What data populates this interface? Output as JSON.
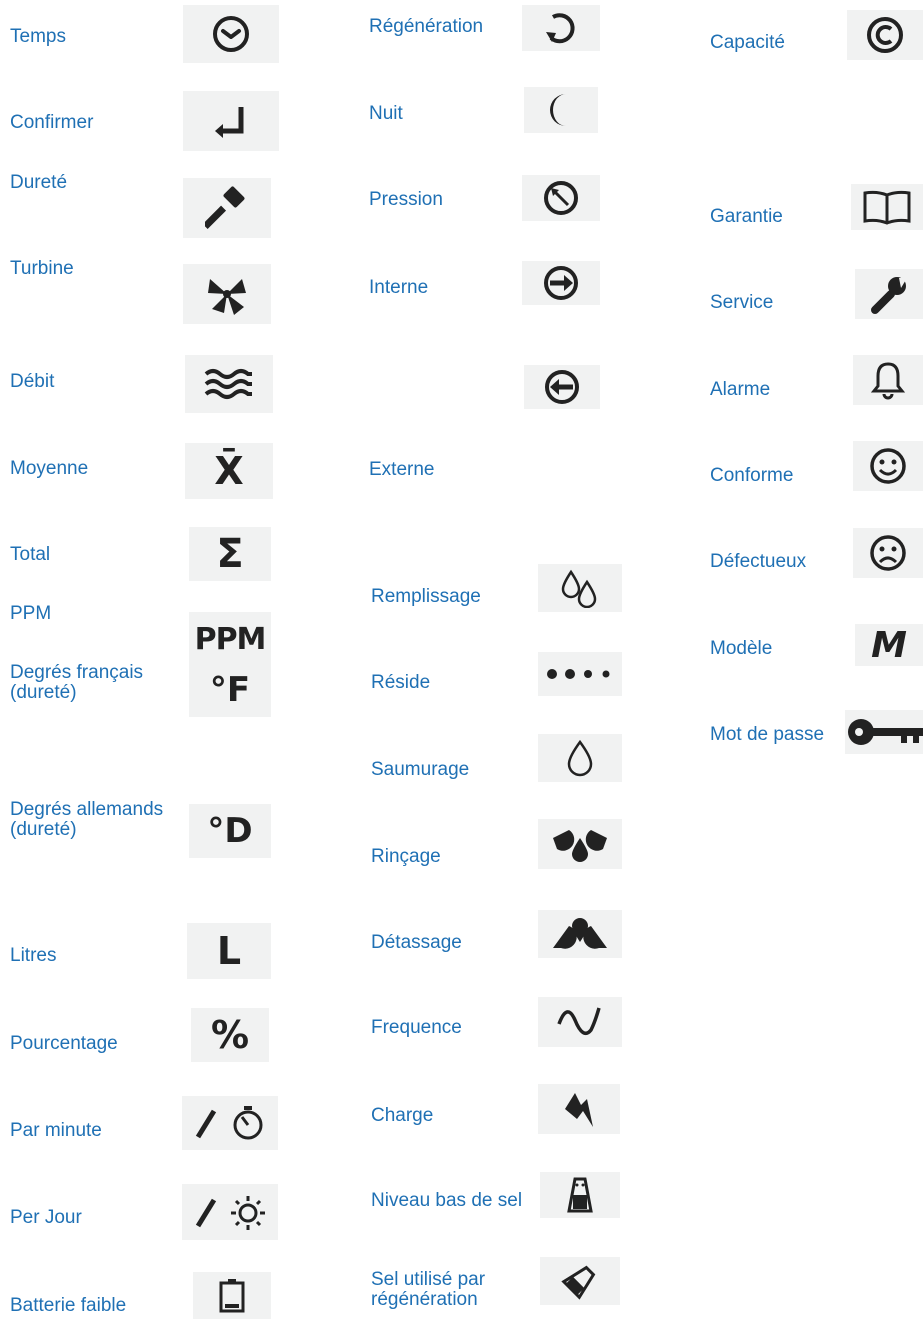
{
  "colors": {
    "label": "#1f70b4",
    "icon_bg": "#f1f2f2",
    "icon_fg": "#222222"
  },
  "col1": {
    "temps": "Temps",
    "temps_icon": "clock-icon",
    "confirmer": "Confirmer",
    "confirmer_icon": "enter-arrow-icon",
    "durete": "Dureté",
    "durete_icon": "hammer-icon",
    "turbine": "Turbine",
    "turbine_icon": "fan-icon",
    "debit": "Débit",
    "debit_icon": "waves-icon",
    "moyenne": "Moyenne",
    "moyenne_icon": "x-bar-icon",
    "moyenne_glyph": "X̄",
    "total": "Total",
    "total_icon": "sigma-icon",
    "total_glyph": "Σ",
    "ppm": "PPM",
    "ppm_icon": "ppm-icon",
    "ppm_glyph": "PPM",
    "degres_fr_1": "Degrés français",
    "degres_fr_2": "(dureté)",
    "degres_fr_icon": "degree-f-icon",
    "degres_fr_glyph": "°F",
    "degres_de_1": "Degrés allemands",
    "degres_de_2": "(dureté)",
    "degres_de_icon": "degree-d-icon",
    "degres_de_glyph": "°D",
    "litres": "Litres",
    "litres_icon": "litre-icon",
    "litres_glyph": "L",
    "pourcentage": "Pourcentage",
    "pourcentage_icon": "percent-icon",
    "pourcentage_glyph": "%",
    "par_minute": "Par minute",
    "par_minute_icon": "per-minute-icon",
    "per_jour": "Per Jour",
    "per_jour_icon": "per-day-icon",
    "batterie": "Batterie faible",
    "batterie_icon": "battery-low-icon"
  },
  "col2": {
    "regeneration": "Régénération",
    "regeneration_icon": "refresh-icon",
    "nuit": "Nuit",
    "nuit_icon": "moon-icon",
    "pression": "Pression",
    "pression_icon": "gauge-icon",
    "interne": "Interne",
    "interne_icon": "arrow-in-icon",
    "externe": "Externe",
    "externe_icon": "arrow-out-icon",
    "remplissage": "Remplissage",
    "remplissage_icon": "two-drops-icon",
    "reside": "Réside",
    "reside_icon": "dots-icon",
    "saumurage": "Saumurage",
    "saumurage_icon": "drop-icon",
    "rincage": "Rinçage",
    "rincage_icon": "rinse-drops-icon",
    "detassage": "Détassage",
    "detassage_icon": "backwash-drops-icon",
    "frequence": "Frequence",
    "frequence_icon": "sine-icon",
    "charge": "Charge",
    "charge_icon": "lightning-icon",
    "niveau_sel": "Niveau bas de sel",
    "niveau_sel_icon": "salt-shaker-icon",
    "sel_utilise_1": "Sel utilisé par",
    "sel_utilise_2": "régénération",
    "sel_utilise_icon": "salt-pour-icon"
  },
  "col3": {
    "capacite": "Capacité",
    "capacite_icon": "copyright-icon",
    "capacite_glyph": "©",
    "garantie": "Garantie",
    "garantie_icon": "book-icon",
    "service": "Service",
    "service_icon": "wrench-icon",
    "alarme": "Alarme",
    "alarme_icon": "bell-icon",
    "conforme": "Conforme",
    "conforme_icon": "smile-icon",
    "defectueux": "Défectueux",
    "defectueux_icon": "frown-icon",
    "modele": "Modèle",
    "modele_icon": "m-icon",
    "modele_glyph": "M",
    "mot_de_passe": "Mot de passe",
    "mot_de_passe_icon": "key-icon"
  }
}
